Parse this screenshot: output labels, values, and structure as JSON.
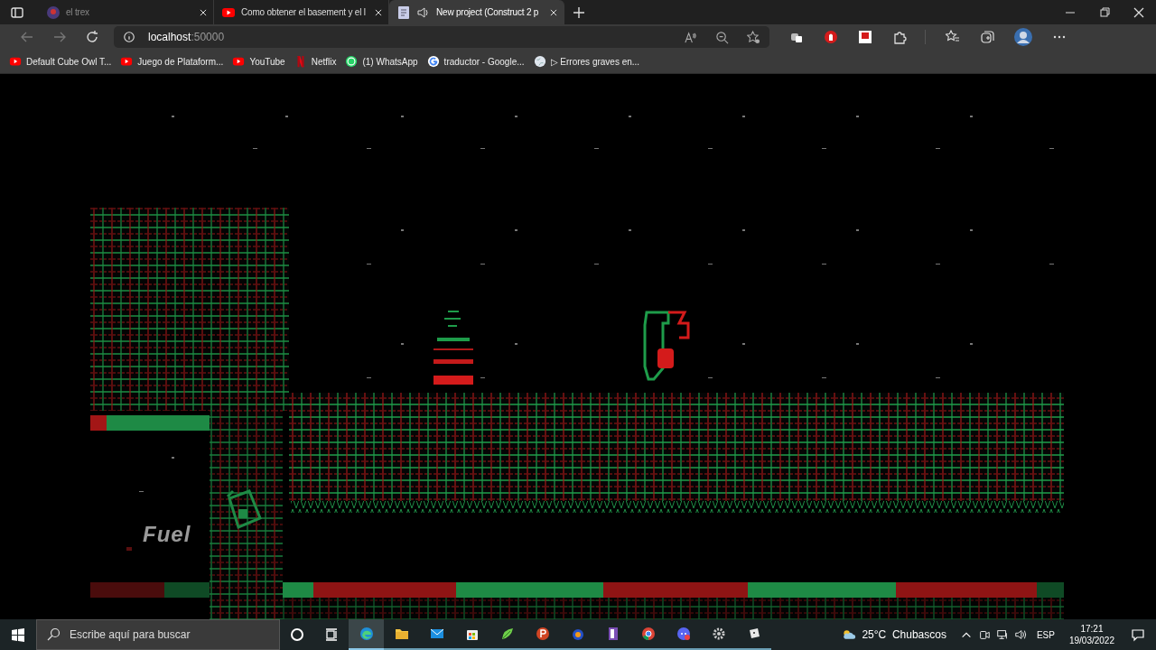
{
  "tabs": [
    {
      "title": "el trex",
      "audio": false,
      "selected": false
    },
    {
      "title": "Como obtener el basement y el l",
      "audio": false,
      "selected": false
    },
    {
      "title": "New project (Construct 2 p",
      "audio": true,
      "selected": true
    }
  ],
  "address": {
    "host": "localhost",
    "port": ":50000"
  },
  "bookmarks": [
    {
      "label": "Default Cube Owl T..."
    },
    {
      "label": "Juego de Plataform..."
    },
    {
      "label": "YouTube"
    },
    {
      "label": "Netflix"
    },
    {
      "label": "(1) WhatsApp"
    },
    {
      "label": "traductor - Google..."
    },
    {
      "label": "▷ Errores graves en..."
    }
  ],
  "game": {
    "fuel_label": "Fuel"
  },
  "taskbar": {
    "search_placeholder": "Escribe aquí para buscar",
    "apps": [
      {
        "kind": "edge",
        "selected": true
      },
      {
        "kind": "folder",
        "selected": false
      },
      {
        "kind": "mail",
        "selected": false
      },
      {
        "kind": "store",
        "selected": false
      },
      {
        "kind": "leaf",
        "selected": false
      },
      {
        "kind": "powerpoint",
        "selected": false
      },
      {
        "kind": "headset",
        "selected": false
      },
      {
        "kind": "book",
        "selected": false
      },
      {
        "kind": "chrome",
        "selected": false
      },
      {
        "kind": "discord",
        "selected": false
      },
      {
        "kind": "gear",
        "selected": false
      },
      {
        "kind": "cube",
        "selected": false
      }
    ],
    "weather": "25°C  Chubascos",
    "language": "ESP",
    "time": "17:21",
    "date": "19/03/2022"
  }
}
